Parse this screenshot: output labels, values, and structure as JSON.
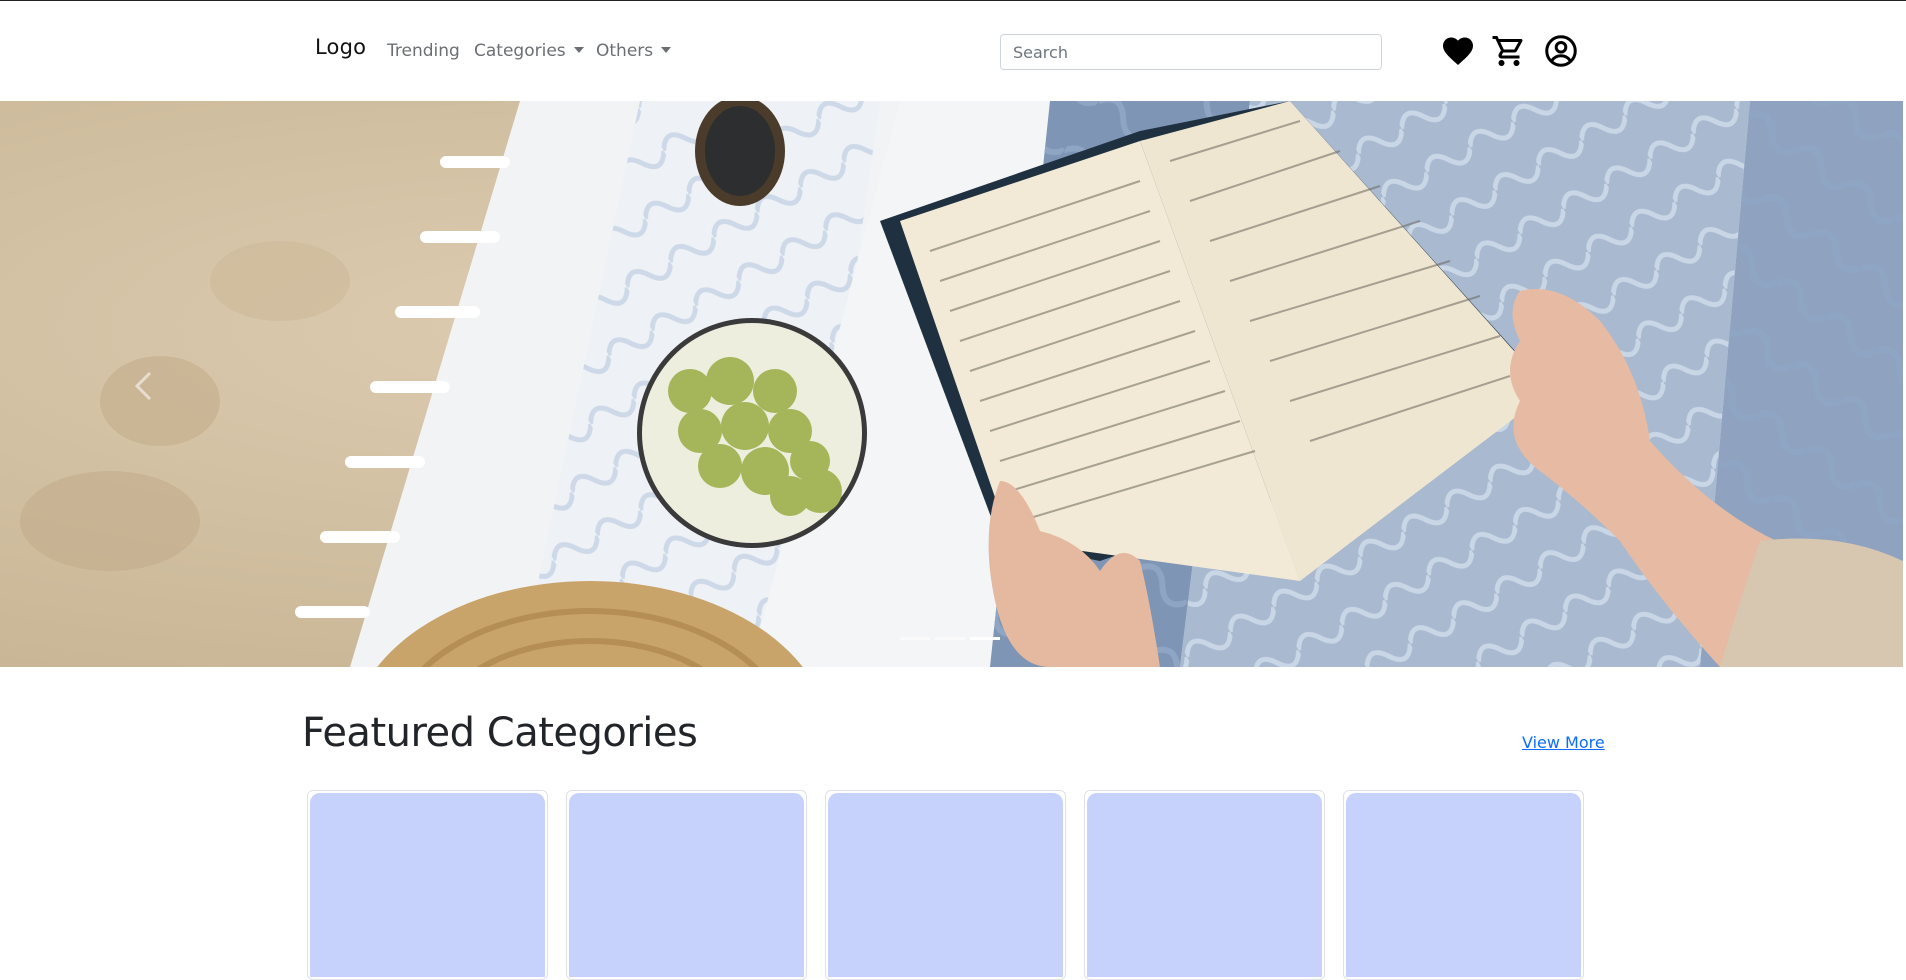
{
  "navbar": {
    "logo": "Logo",
    "links": [
      {
        "label": "Trending"
      },
      {
        "label": "Categories"
      },
      {
        "label": "Others"
      }
    ],
    "search": {
      "placeholder": "Search",
      "value": ""
    },
    "icons": [
      "heart-icon",
      "cart-icon",
      "user-icon"
    ]
  },
  "hero": {
    "slide_count": 3,
    "active_slide": 3,
    "image": "beach-reading-scene"
  },
  "featured": {
    "title": "Featured Categories",
    "view_more": "View More",
    "card_count": 5
  },
  "colors": {
    "accent": "#0d6efd",
    "card_placeholder": "#c6d2fc",
    "text": "#212529",
    "nav_link": "#6b6f73"
  }
}
